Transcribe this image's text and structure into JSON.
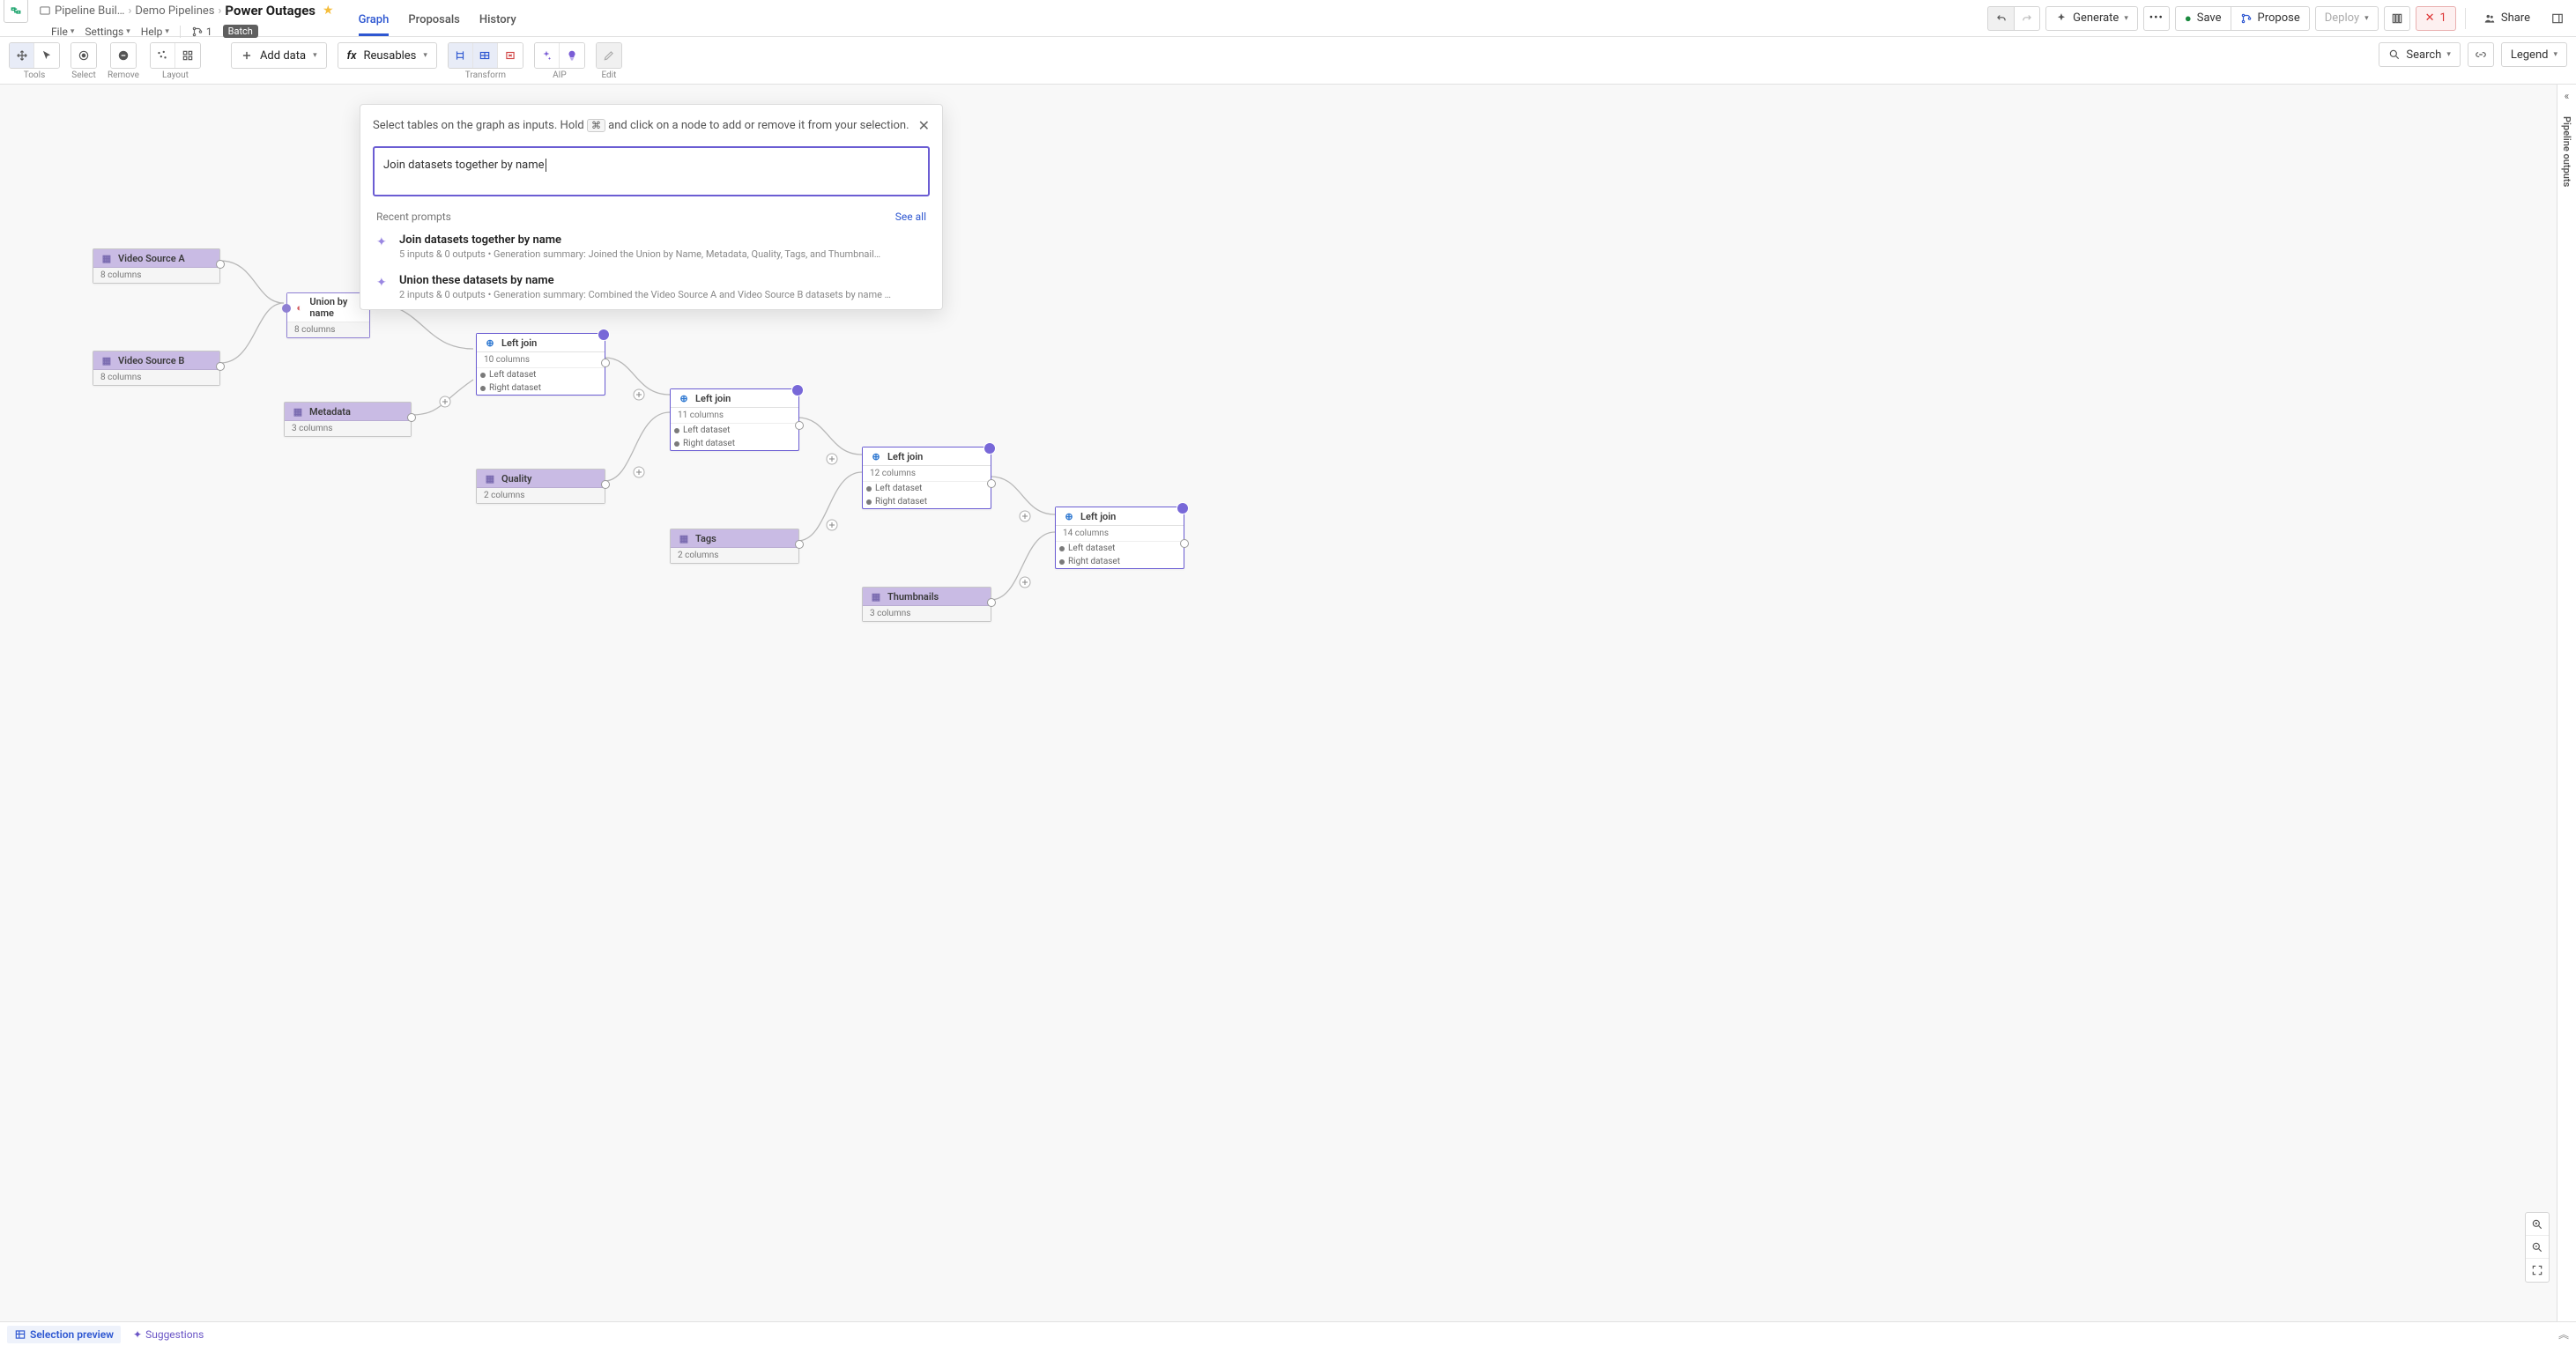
{
  "header": {
    "breadcrumb": [
      "Pipeline Buil…",
      "Demo Pipelines",
      "Power Outages"
    ],
    "menus": {
      "file": "File",
      "settings": "Settings",
      "help": "Help",
      "branch_count": "1",
      "batch": "Batch"
    },
    "tabs": {
      "graph": "Graph",
      "proposals": "Proposals",
      "history": "History"
    },
    "actions": {
      "generate": "Generate",
      "save": "Save",
      "propose": "Propose",
      "deploy": "Deploy",
      "errors": "1",
      "share": "Share"
    }
  },
  "toolbar": {
    "groups": {
      "tools": "Tools",
      "select": "Select",
      "remove": "Remove",
      "layout": "Layout",
      "transform": "Transform",
      "aip": "AIP",
      "edit": "Edit"
    },
    "add_data": "Add data",
    "reusables": "Reusables",
    "search": "Search",
    "legend": "Legend"
  },
  "side_rail": {
    "label": "Pipeline outputs"
  },
  "bottombar": {
    "selection_preview": "Selection preview",
    "suggestions": "Suggestions"
  },
  "popover": {
    "hint_pre": "Select tables on the graph as inputs. Hold ",
    "hint_key": "⌘",
    "hint_post": " and click on a node to add or remove it from your selection.",
    "input_value": "Join datasets together by name",
    "recent_label": "Recent prompts",
    "see_all": "See all",
    "recent": [
      {
        "title": "Join datasets together by name",
        "sub": "5 inputs & 0 outputs  •  Generation summary: Joined the Union by Name, Metadata, Quality, Tags, and Thumbnail…"
      },
      {
        "title": "Union these datasets by name",
        "sub": "2 inputs & 0 outputs  •  Generation summary: Combined the Video Source A and Video Source B datasets by name …"
      }
    ]
  },
  "nodes": {
    "vsA": {
      "title": "Video Source A",
      "cols": "8 columns"
    },
    "vsB": {
      "title": "Video Source B",
      "cols": "8 columns"
    },
    "union": {
      "title": "Union by name",
      "cols": "8 columns"
    },
    "meta": {
      "title": "Metadata",
      "cols": "3 columns"
    },
    "qual": {
      "title": "Quality",
      "cols": "2 columns"
    },
    "tags": {
      "title": "Tags",
      "cols": "2 columns"
    },
    "thumb": {
      "title": "Thumbnails",
      "cols": "3 columns"
    },
    "join1": {
      "title": "Left join",
      "cols": "10 columns",
      "p1": "Left dataset",
      "p2": "Right dataset"
    },
    "join2": {
      "title": "Left join",
      "cols": "11 columns",
      "p1": "Left dataset",
      "p2": "Right dataset"
    },
    "join3": {
      "title": "Left join",
      "cols": "12 columns",
      "p1": "Left dataset",
      "p2": "Right dataset"
    },
    "join4": {
      "title": "Left join",
      "cols": "14 columns",
      "p1": "Left dataset",
      "p2": "Right dataset"
    }
  }
}
